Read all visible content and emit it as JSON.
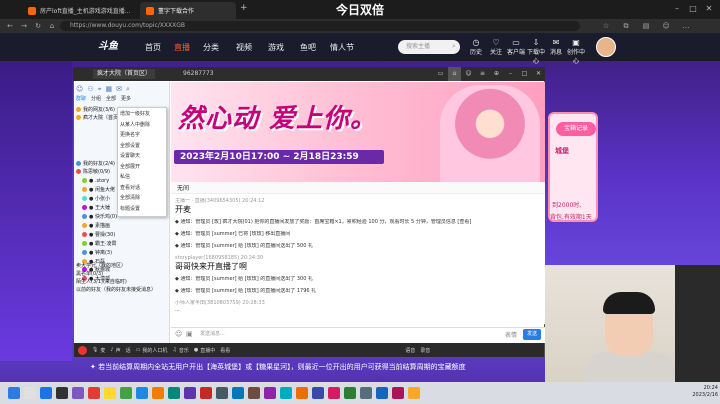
{
  "browser": {
    "tabs": [
      {
        "title": "房产loft直播_主机游戏游戏直播..."
      },
      {
        "title": "董字下载合作"
      }
    ],
    "overlay_title": "今日双倍",
    "url": "https://www.douyu.com/topic/XXXXGB"
  },
  "site": {
    "logo": "斗鱼",
    "nav": [
      "首页",
      "直播",
      "分类",
      "视频",
      "游戏",
      "鱼吧",
      "情人节"
    ],
    "search_placeholder": "搜索主播",
    "top_icons": [
      {
        "icon": "history-icon",
        "label": "历史"
      },
      {
        "icon": "follow-icon",
        "label": "关注"
      },
      {
        "icon": "app-icon",
        "label": "客户端"
      },
      {
        "icon": "download-icon",
        "label": "下载中心"
      },
      {
        "icon": "message-icon",
        "label": "消息"
      },
      {
        "icon": "creator-icon",
        "label": "创作中心"
      }
    ],
    "right_banner": {
      "btn": "宝箱记录",
      "t1": "城堡",
      "t2": "到2000时,",
      "t3": "背包,有效期1天"
    },
    "notice": "✦  若当前结算周期内全站无用户开出【海英城堡】或【糖果星河】，则最近一位开出的用户可获得当前结算周期的宝藏额度"
  },
  "qq": {
    "title": "疯才大院（首页区）",
    "num": "96287773",
    "right_icons": [
      "screen",
      "home",
      "user",
      "more",
      "pin",
      "min",
      "max",
      "close"
    ],
    "tabs": [
      "群聊",
      "分组",
      "全部",
      "更多"
    ],
    "contacts": [
      {
        "name": "我的网友(3/6)",
        "color": "#f5a623"
      },
      {
        "name": "疯才大院（首页）",
        "color": "#f5a623"
      },
      {
        "name": "我的好友(2/4)",
        "color": "#4a90e2"
      },
      {
        "name": "陈思敏(0/9)",
        "color": "#e94f4f"
      },
      {
        "name": "● .story",
        "color": "#7ed321"
      },
      {
        "name": "● 闲鱼大佬",
        "color": "#f5a623"
      },
      {
        "name": "● 小张小",
        "color": "#50e3c2"
      },
      {
        "name": "● 王大锤",
        "color": "#bd10e0"
      },
      {
        "name": "● 快乐鸡(0)",
        "color": "#4a90e2"
      },
      {
        "name": "● 素描画",
        "color": "#f5a623"
      },
      {
        "name": "● 曹操(30)",
        "color": "#e94f4f"
      },
      {
        "name": "● 霸王·凌霄",
        "color": "#7ed321"
      },
      {
        "name": "● 钟离(3)",
        "color": "#4a90e2"
      },
      {
        "name": "● 石磊",
        "color": "#f5a623"
      },
      {
        "name": "● 秋蕾城",
        "color": "#bd10e0"
      },
      {
        "name": "● 大漠孤",
        "color": "#e94f4f"
      },
      {
        "name": "卖大学兄（我的地区）",
        "color": "#4a90e2"
      },
      {
        "name": "黑名单(0/3)",
        "color": "#888888"
      },
      {
        "name": "陌生人(3/1)(来自临时)",
        "color": "#888888"
      },
      {
        "name": "以前的好友（我的好友未接受消息）",
        "color": "#888888"
      }
    ],
    "context_menu": [
      "增加一级好友",
      "从某人中删除",
      "更换名字",
      "全部设置",
      "设置聊天",
      "全部展开",
      "私信",
      "查看对话",
      "全部清除",
      "标题设置"
    ],
    "header_text": "然心动 爱上你。",
    "header_date": "2023年2月10日17:00 ~ 2月18日23:59",
    "chat_bar": "无间",
    "messages": [
      {
        "meta": "主播一 · 直播(3409654305)  20:24:12",
        "text": "开麦",
        "big": true
      },
      {
        "meta": "",
        "text": "◆ 通知：管理员 [玫] 疯才大院(01) 把你的直播间发放了奖励：首席宝箱×1，累积经验 100 分，观看时长 5 分钟，管理员信息 [查看]",
        "big": false
      },
      {
        "meta": "",
        "text": "◆ 通知：管理员 [summer] 已将 [玫玫] 移出直播间",
        "big": false
      },
      {
        "meta": "",
        "text": "◆ 通知：管理员 [summer] 给 [玫玫] 的直播间送出了 500 礼",
        "big": false
      },
      {
        "meta": "storyplayer(1680958185)  20:24:30",
        "text": "哥哥快来开直播了啊",
        "big": true
      },
      {
        "meta": "",
        "text": "◆ 通知：管理员 [summer] 给 [玫玫] 的直播间送出了 300 礼",
        "big": false
      },
      {
        "meta": "",
        "text": "◆ 通知：管理员 [summer] 给 [玫玫] 的直播间送出了 1796 礼",
        "big": false
      },
      {
        "meta": "小师人家半田(3810803759)  20:28:33",
        "text": "...",
        "big": false
      }
    ],
    "input_placeholder": "发送消息...",
    "toolbar": [
      "麦",
      "声",
      "话",
      "我的人口机",
      "音乐",
      "直播中",
      "看看",
      "语音",
      "录音"
    ],
    "send_btns": [
      "表情",
      "发送"
    ]
  },
  "taskbar": {
    "time": "20:24",
    "date": "2023/2/16"
  }
}
